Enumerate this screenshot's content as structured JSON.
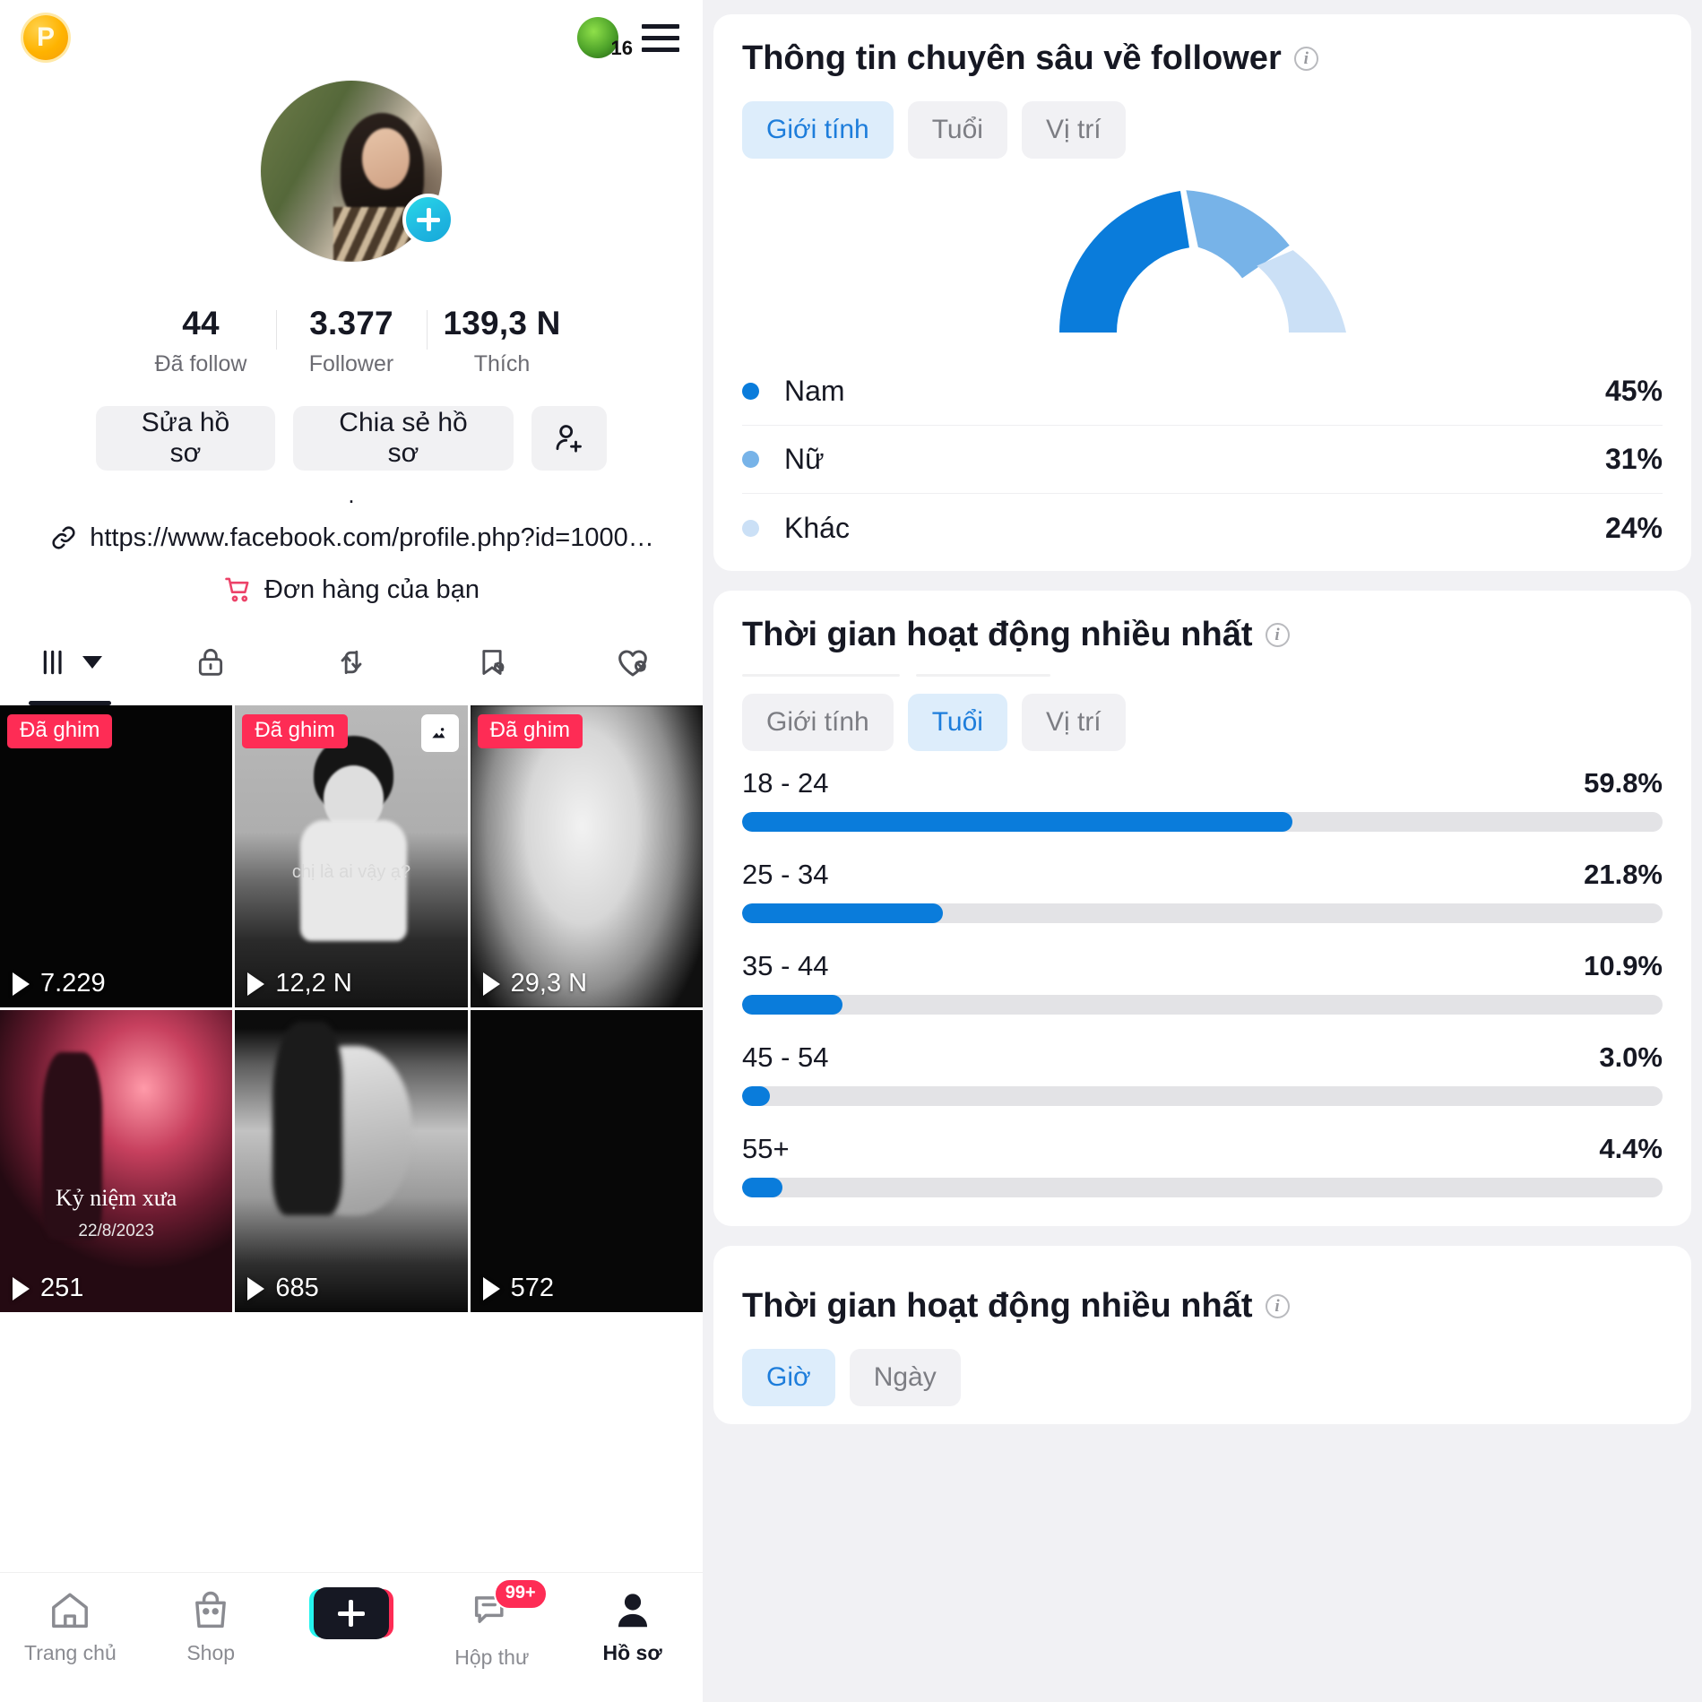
{
  "profile": {
    "coin_badge": "P",
    "leaf_count": "16",
    "stats": [
      {
        "value": "44",
        "label": "Đã follow"
      },
      {
        "value": "3.377",
        "label": "Follower"
      },
      {
        "value": "139,3 N",
        "label": "Thích"
      }
    ],
    "buttons": {
      "edit": "Sửa hồ sơ",
      "share": "Chia sẻ hồ sơ",
      "add_friend_icon": "person-add-icon"
    },
    "bio": ".",
    "link": "https://www.facebook.com/profile.php?id=1000…",
    "order_row": "Đơn hàng của bạn",
    "tabs": [
      {
        "icon": "grid-posts-icon",
        "active": true
      },
      {
        "icon": "lock-private-icon",
        "active": false
      },
      {
        "icon": "repost-icon",
        "active": false
      },
      {
        "icon": "bookmark-hidden-icon",
        "active": false
      },
      {
        "icon": "heart-hidden-icon",
        "active": false
      }
    ],
    "pin_label": "Đã ghim",
    "videos": [
      {
        "views": "7.229",
        "pinned": true,
        "multi": false,
        "caption": ""
      },
      {
        "views": "12,2 N",
        "pinned": true,
        "multi": true,
        "caption": "chị là ai vậy ạ?"
      },
      {
        "views": "29,3 N",
        "pinned": true,
        "multi": false,
        "caption": ""
      },
      {
        "views": "251",
        "pinned": false,
        "multi": false,
        "caption": "Kỷ niệm xưa"
      },
      {
        "views": "685",
        "pinned": false,
        "multi": false,
        "caption": ""
      },
      {
        "views": "572",
        "pinned": false,
        "multi": false,
        "caption": ""
      }
    ],
    "video_sub_caption": "22/8/2023",
    "bottom_nav": [
      {
        "label": "Trang chủ",
        "icon": "home-icon",
        "active": false
      },
      {
        "label": "Shop",
        "icon": "shop-bag-icon",
        "active": false
      },
      {
        "label": "",
        "icon": "create-plus-icon",
        "active": false
      },
      {
        "label": "Hộp thư",
        "icon": "inbox-icon",
        "active": false,
        "badge": "99+"
      },
      {
        "label": "Hồ sơ",
        "icon": "profile-person-icon",
        "active": true
      }
    ]
  },
  "analytics": {
    "follower_card": {
      "title": "Thông tin chuyên sâu về follower",
      "info_icon": "info-icon",
      "tabs": [
        {
          "label": "Giới tính",
          "active": true
        },
        {
          "label": "Tuổi",
          "active": false
        },
        {
          "label": "Vị trí",
          "active": false
        }
      ]
    },
    "active_time_card": {
      "title": "Thời gian hoạt động nhiều nhất",
      "info_icon": "info-icon",
      "tabs": [
        {
          "label": "Giới tính",
          "active": false
        },
        {
          "label": "Tuổi",
          "active": true
        },
        {
          "label": "Vị trí",
          "active": false
        }
      ]
    },
    "active_hours_card": {
      "title": "Thời gian hoạt động nhiều nhất",
      "info_icon": "info-icon",
      "tabs": [
        {
          "label": "Giờ",
          "active": true
        },
        {
          "label": "Ngày",
          "active": false
        }
      ]
    }
  },
  "chart_data": [
    {
      "type": "pie",
      "title": "Thông tin chuyên sâu về follower",
      "subtitle": "Giới tính",
      "shape": "half-donut-gauge",
      "legend_position": "below",
      "labels": [
        "Nam",
        "Nữ",
        "Khác"
      ],
      "values": [
        45,
        31,
        24
      ],
      "value_labels": [
        "45%",
        "31%",
        "24%"
      ],
      "colors": [
        "#0a7cdb",
        "#77b3e8",
        "#cbe0f6"
      ],
      "unit": "%"
    },
    {
      "type": "bar",
      "orientation": "horizontal",
      "title": "Thời gian hoạt động nhiều nhất",
      "subtitle": "Tuổi",
      "categories": [
        "18 - 24",
        "25 - 34",
        "35 - 44",
        "45 - 54",
        "55+"
      ],
      "values": [
        59.8,
        21.8,
        10.9,
        3.0,
        4.4
      ],
      "value_labels": [
        "59.8%",
        "21.8%",
        "10.9%",
        "3.0%",
        "4.4%"
      ],
      "xlabel": "",
      "ylabel": "",
      "xlim": [
        0,
        100
      ],
      "grid": false,
      "bar_color": "#0a7cdb",
      "track_color": "#e3e3e6",
      "unit": "%"
    }
  ]
}
